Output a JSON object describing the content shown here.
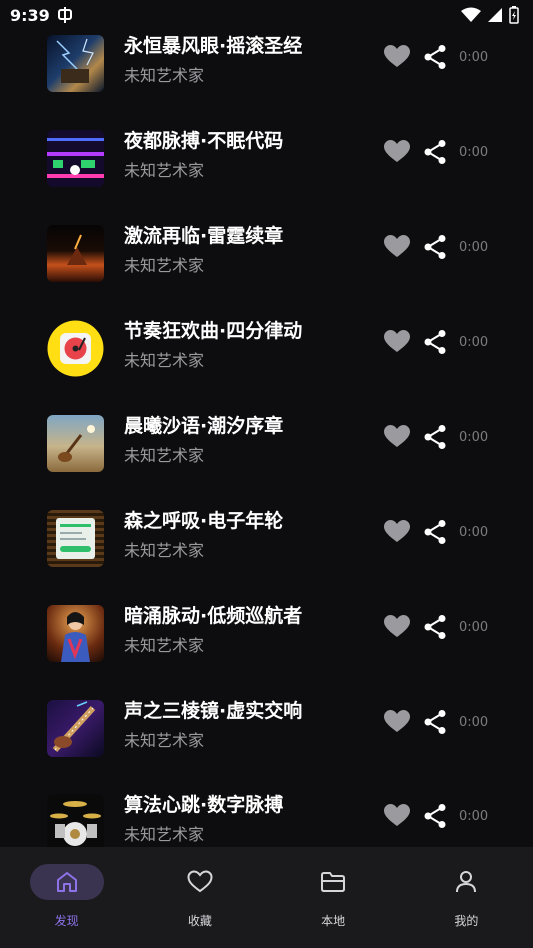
{
  "status": {
    "time": "9:39"
  },
  "songs": [
    {
      "title": "永恒暴风眼·摇滚圣经",
      "artist": "未知艺术家",
      "duration": "0:00"
    },
    {
      "title": "夜都脉搏·不眠代码",
      "artist": "未知艺术家",
      "duration": "0:00"
    },
    {
      "title": "激流再临·雷霆续章",
      "artist": "未知艺术家",
      "duration": "0:00"
    },
    {
      "title": "节奏狂欢曲·四分律动",
      "artist": "未知艺术家",
      "duration": "0:00"
    },
    {
      "title": "晨曦沙语·潮汐序章",
      "artist": "未知艺术家",
      "duration": "0:00"
    },
    {
      "title": "森之呼吸·电子年轮",
      "artist": "未知艺术家",
      "duration": "0:00"
    },
    {
      "title": "暗涌脉动·低频巡航者",
      "artist": "未知艺术家",
      "duration": "0:00"
    },
    {
      "title": "声之三棱镜·虚实交响",
      "artist": "未知艺术家",
      "duration": "0:00"
    },
    {
      "title": "算法心跳·数字脉搏",
      "artist": "未知艺术家",
      "duration": "0:00"
    }
  ],
  "nav": {
    "discover": "发现",
    "favorites": "收藏",
    "local": "本地",
    "mine": "我的"
  },
  "colors": {
    "accent": "#8d72e8",
    "background": "#0d0d0f",
    "nav_bg": "#1a1a1d"
  }
}
